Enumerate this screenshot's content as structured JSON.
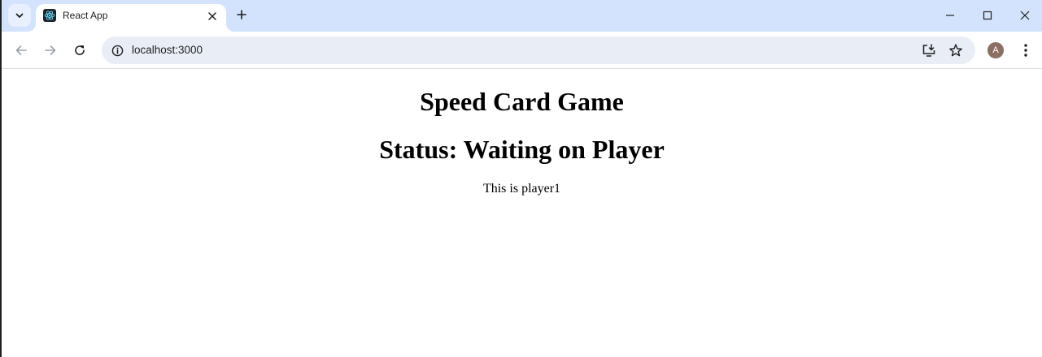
{
  "browser": {
    "tab_title": "React App",
    "url": "localhost:3000",
    "profile_initial": "A",
    "accent": "#d3e3fd",
    "omnibox_bg": "#e9eef6",
    "avatar_color": "#8d6e63"
  },
  "icons": {
    "tab_search": "chevron-down-icon",
    "favicon": "react-logo-icon",
    "tab_close": "close-icon",
    "new_tab": "plus-icon",
    "minimize": "minimize-icon",
    "maximize": "maximize-icon",
    "close_window": "close-icon",
    "back": "arrow-left-icon",
    "forward": "arrow-right-icon",
    "reload": "reload-icon",
    "site_info": "info-icon",
    "install": "install-app-icon",
    "bookmark": "star-icon",
    "menu": "more-vert-icon"
  },
  "page": {
    "title": "Speed Card Game",
    "status": "Status: Waiting on Player",
    "player_text": "This is player1"
  }
}
